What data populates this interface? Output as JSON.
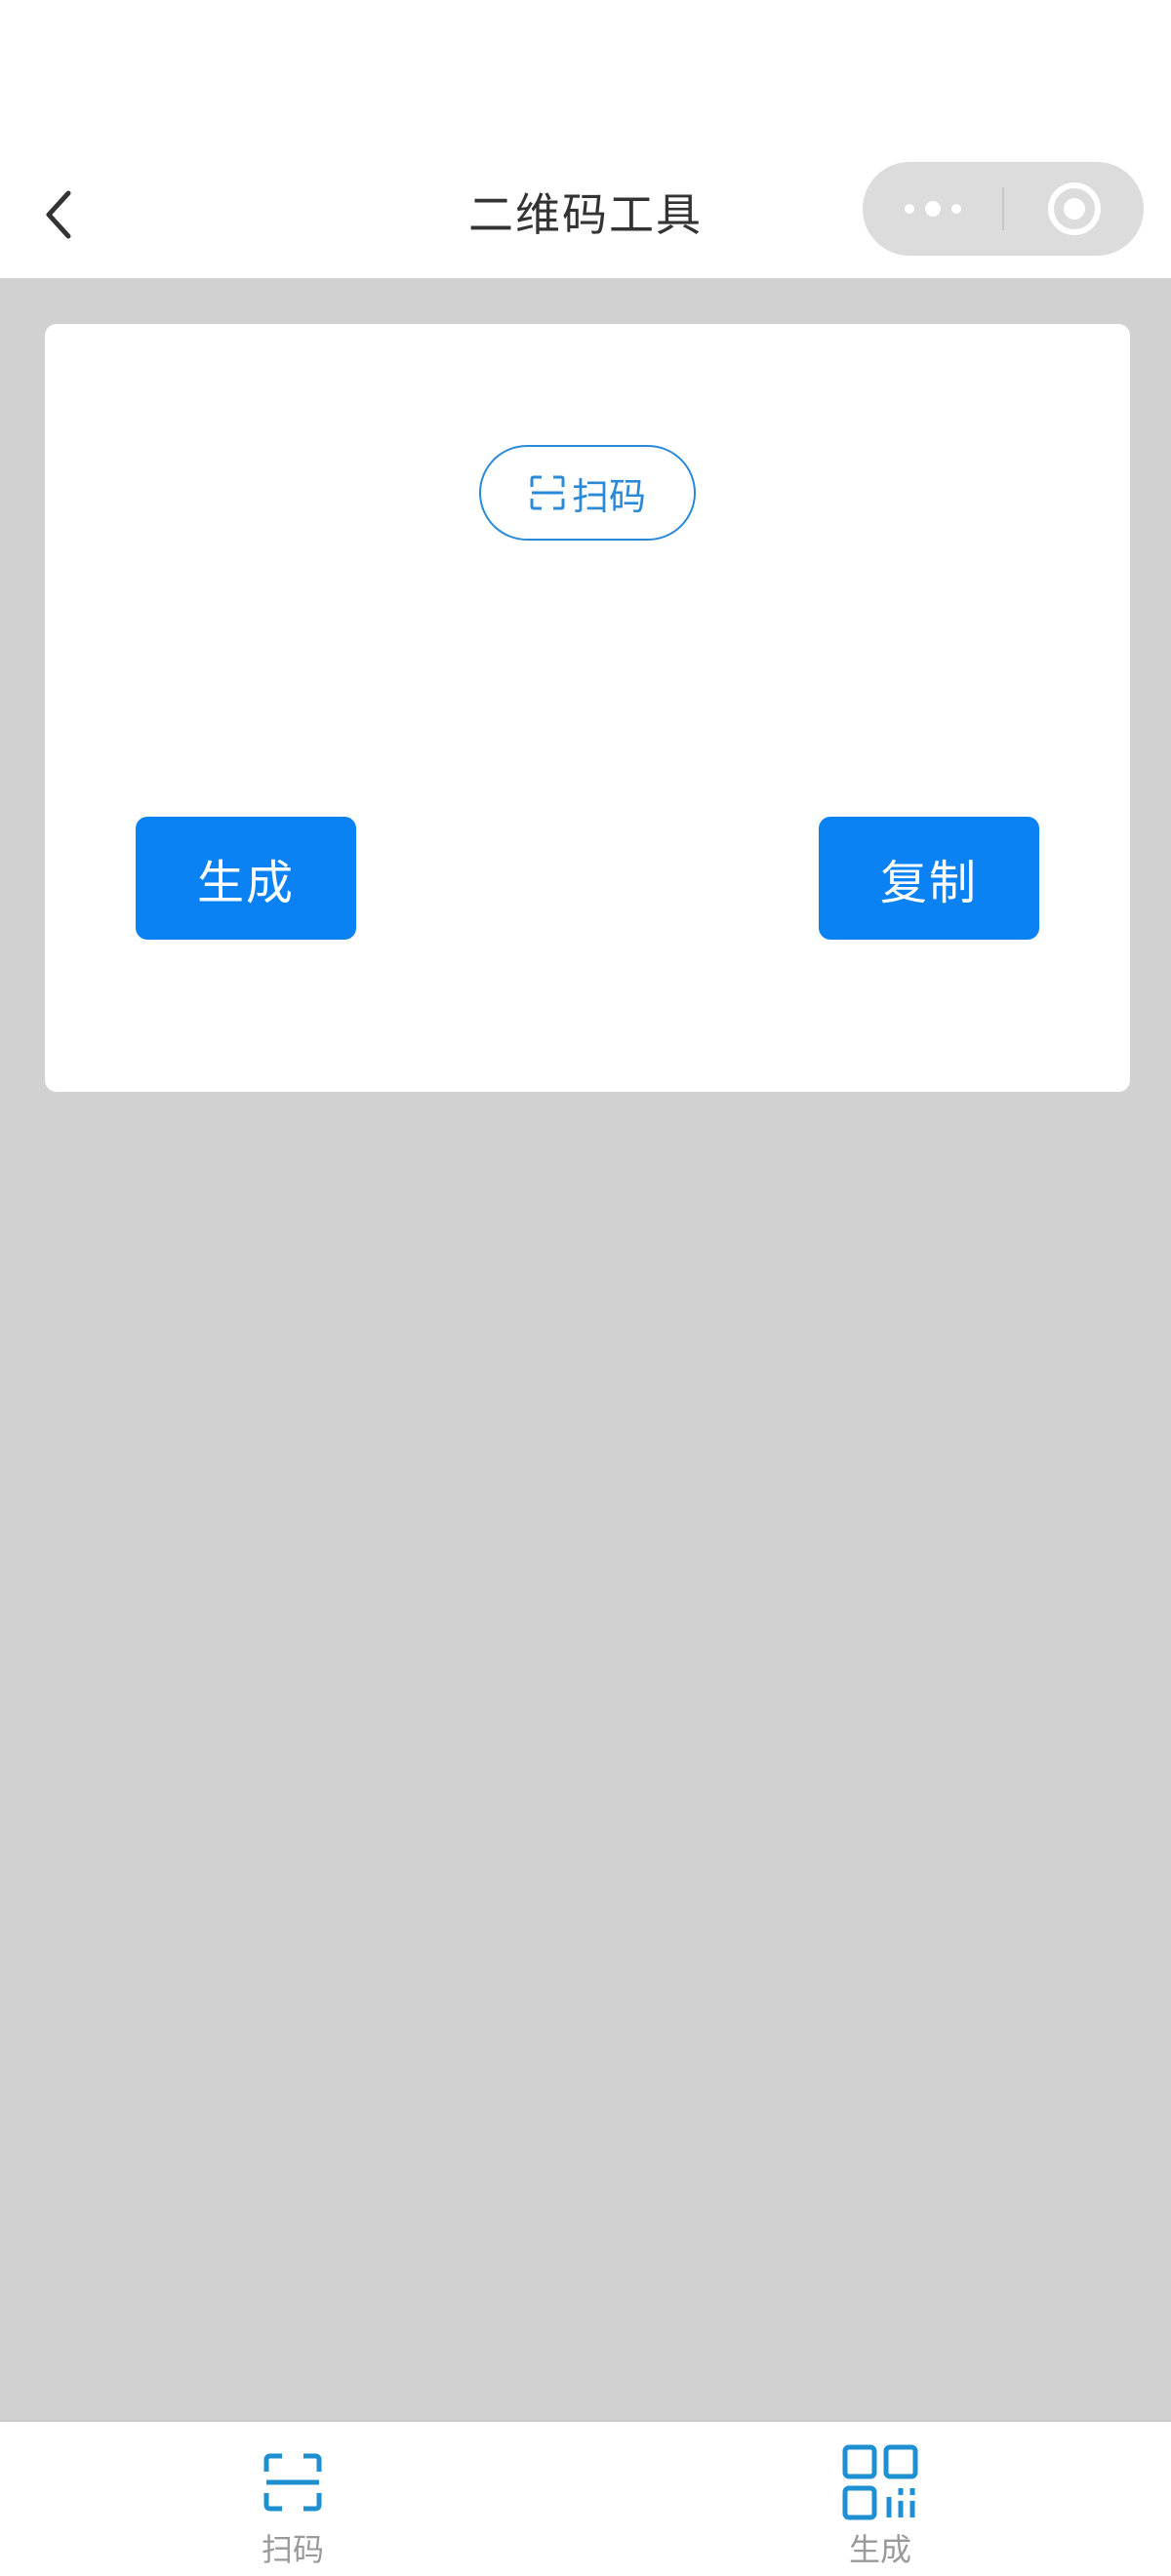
{
  "nav": {
    "title": "二维码工具",
    "back_icon": "chevron-left-icon",
    "more_icon": "more-dots-icon",
    "close_icon": "target-circle-icon"
  },
  "card": {
    "scan_label": "扫码",
    "scan_icon": "scan-frame-icon",
    "generate_label": "生成",
    "copy_label": "复制"
  },
  "tabbar": {
    "items": [
      {
        "label": "扫码",
        "icon": "scan-frame-icon"
      },
      {
        "label": "生成",
        "icon": "qr-code-icon"
      }
    ]
  },
  "colors": {
    "accent": "#0a82f4",
    "outline": "#2b8ad8",
    "background": "#d1d1d1",
    "tab_icon": "#1e8fd0",
    "tab_label": "#9a9a9a"
  }
}
